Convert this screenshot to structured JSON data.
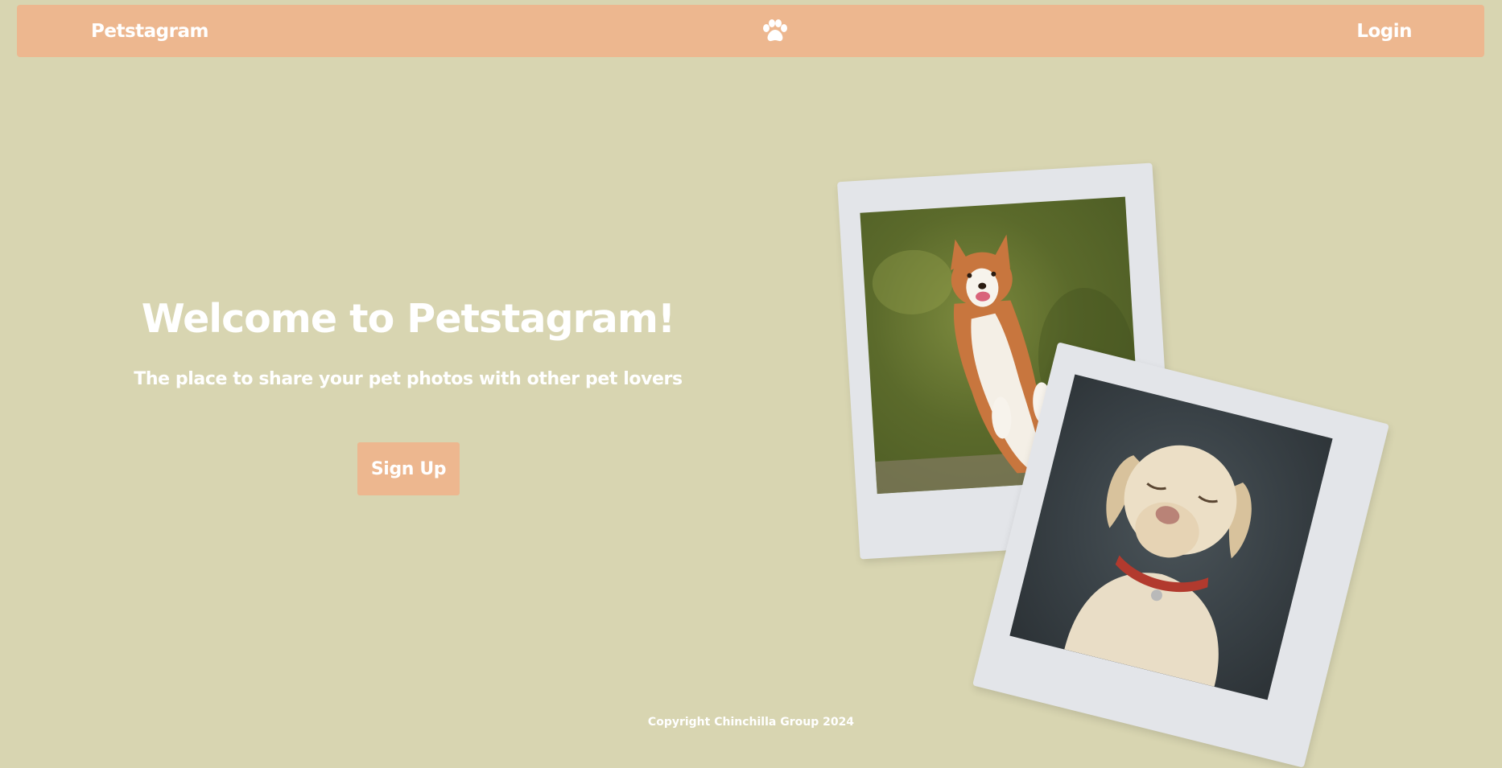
{
  "nav": {
    "brand": "Petstagram",
    "logo_icon": "paw-icon",
    "login": "Login"
  },
  "hero": {
    "title": "Welcome to Petstagram!",
    "subtitle": "The place to share your pet photos with other pet lovers",
    "signup": "Sign Up"
  },
  "photos": [
    {
      "subject": "corgi standing on hind legs"
    },
    {
      "subject": "labrador with red collar"
    }
  ],
  "footer": {
    "copyright": "Copyright Chinchilla Group 2024"
  },
  "colors": {
    "background": "#d8d5b1",
    "accent": "#edb78f",
    "text": "#ffffff"
  }
}
